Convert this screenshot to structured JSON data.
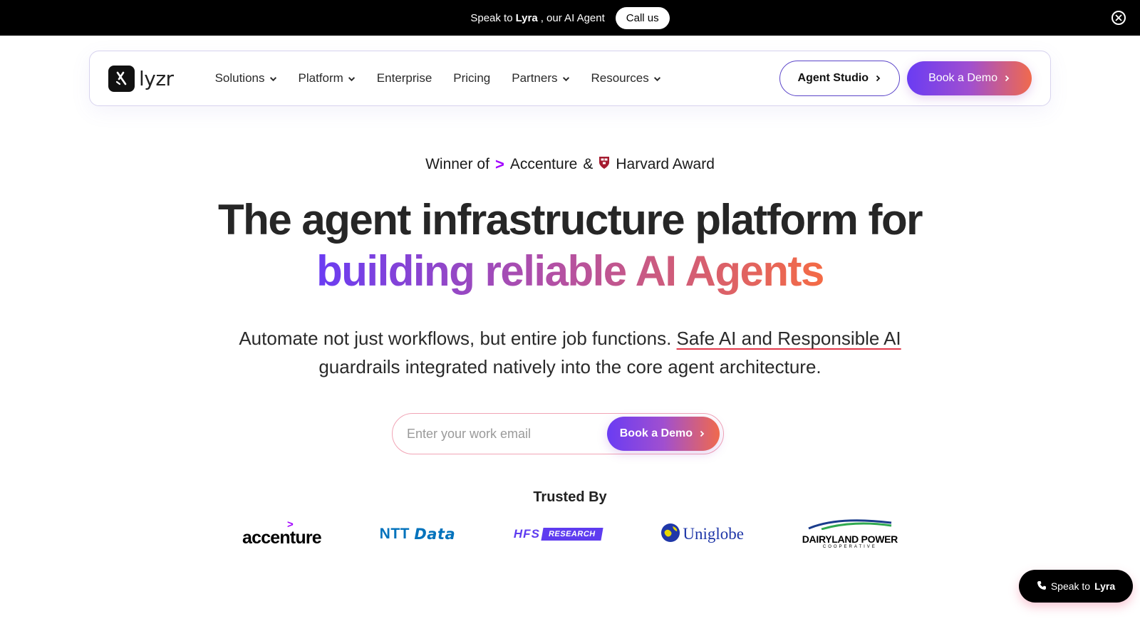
{
  "topbar": {
    "speak_prefix": "Speak to",
    "speak_name": "Lyra",
    "speak_suffix": ", our AI Agent",
    "call_label": "Call us",
    "close_icon": "close-circle-icon"
  },
  "nav": {
    "logo_text": "lyzr",
    "menu": [
      {
        "label": "Solutions",
        "dropdown": true
      },
      {
        "label": "Platform",
        "dropdown": true
      },
      {
        "label": "Enterprise",
        "dropdown": false
      },
      {
        "label": "Pricing",
        "dropdown": false
      },
      {
        "label": "Partners",
        "dropdown": true
      },
      {
        "label": "Resources",
        "dropdown": true
      }
    ],
    "agent_studio_label": "Agent Studio",
    "book_demo_label": "Book a Demo"
  },
  "hero": {
    "award_prefix": "Winner of",
    "award_accenture": "Accenture",
    "award_and": "&",
    "award_harvard": "Harvard Award",
    "title_line1": "The agent infrastructure platform for",
    "title_line2": "building reliable AI Agents",
    "subtitle_part1": "Automate not just workflows, but entire job functions.",
    "subtitle_link": "Safe AI and Responsible AI",
    "subtitle_line2": "guardrails integrated natively into the core agent architecture.",
    "email_placeholder": "Enter your work email",
    "email_button_label": "Book a Demo"
  },
  "trusted": {
    "heading": "Trusted By",
    "logos": {
      "accenture": "accenture",
      "ntt_a": "NTT",
      "ntt_b": "Data",
      "hfs_a": "HFS",
      "hfs_b": "RESEARCH",
      "uniglobe": "Uniglobe",
      "dairyland": "DAIRYLAND POWER",
      "dairyland_sub": "COOPERATIVE"
    }
  },
  "floating": {
    "prefix": "Speak to",
    "name": "Lyra"
  },
  "colors": {
    "accent_purple": "#6a3cf3",
    "accent_orange": "#f06a4d",
    "accenture_purple": "#a100ff",
    "ntt_blue": "#0072bc"
  }
}
